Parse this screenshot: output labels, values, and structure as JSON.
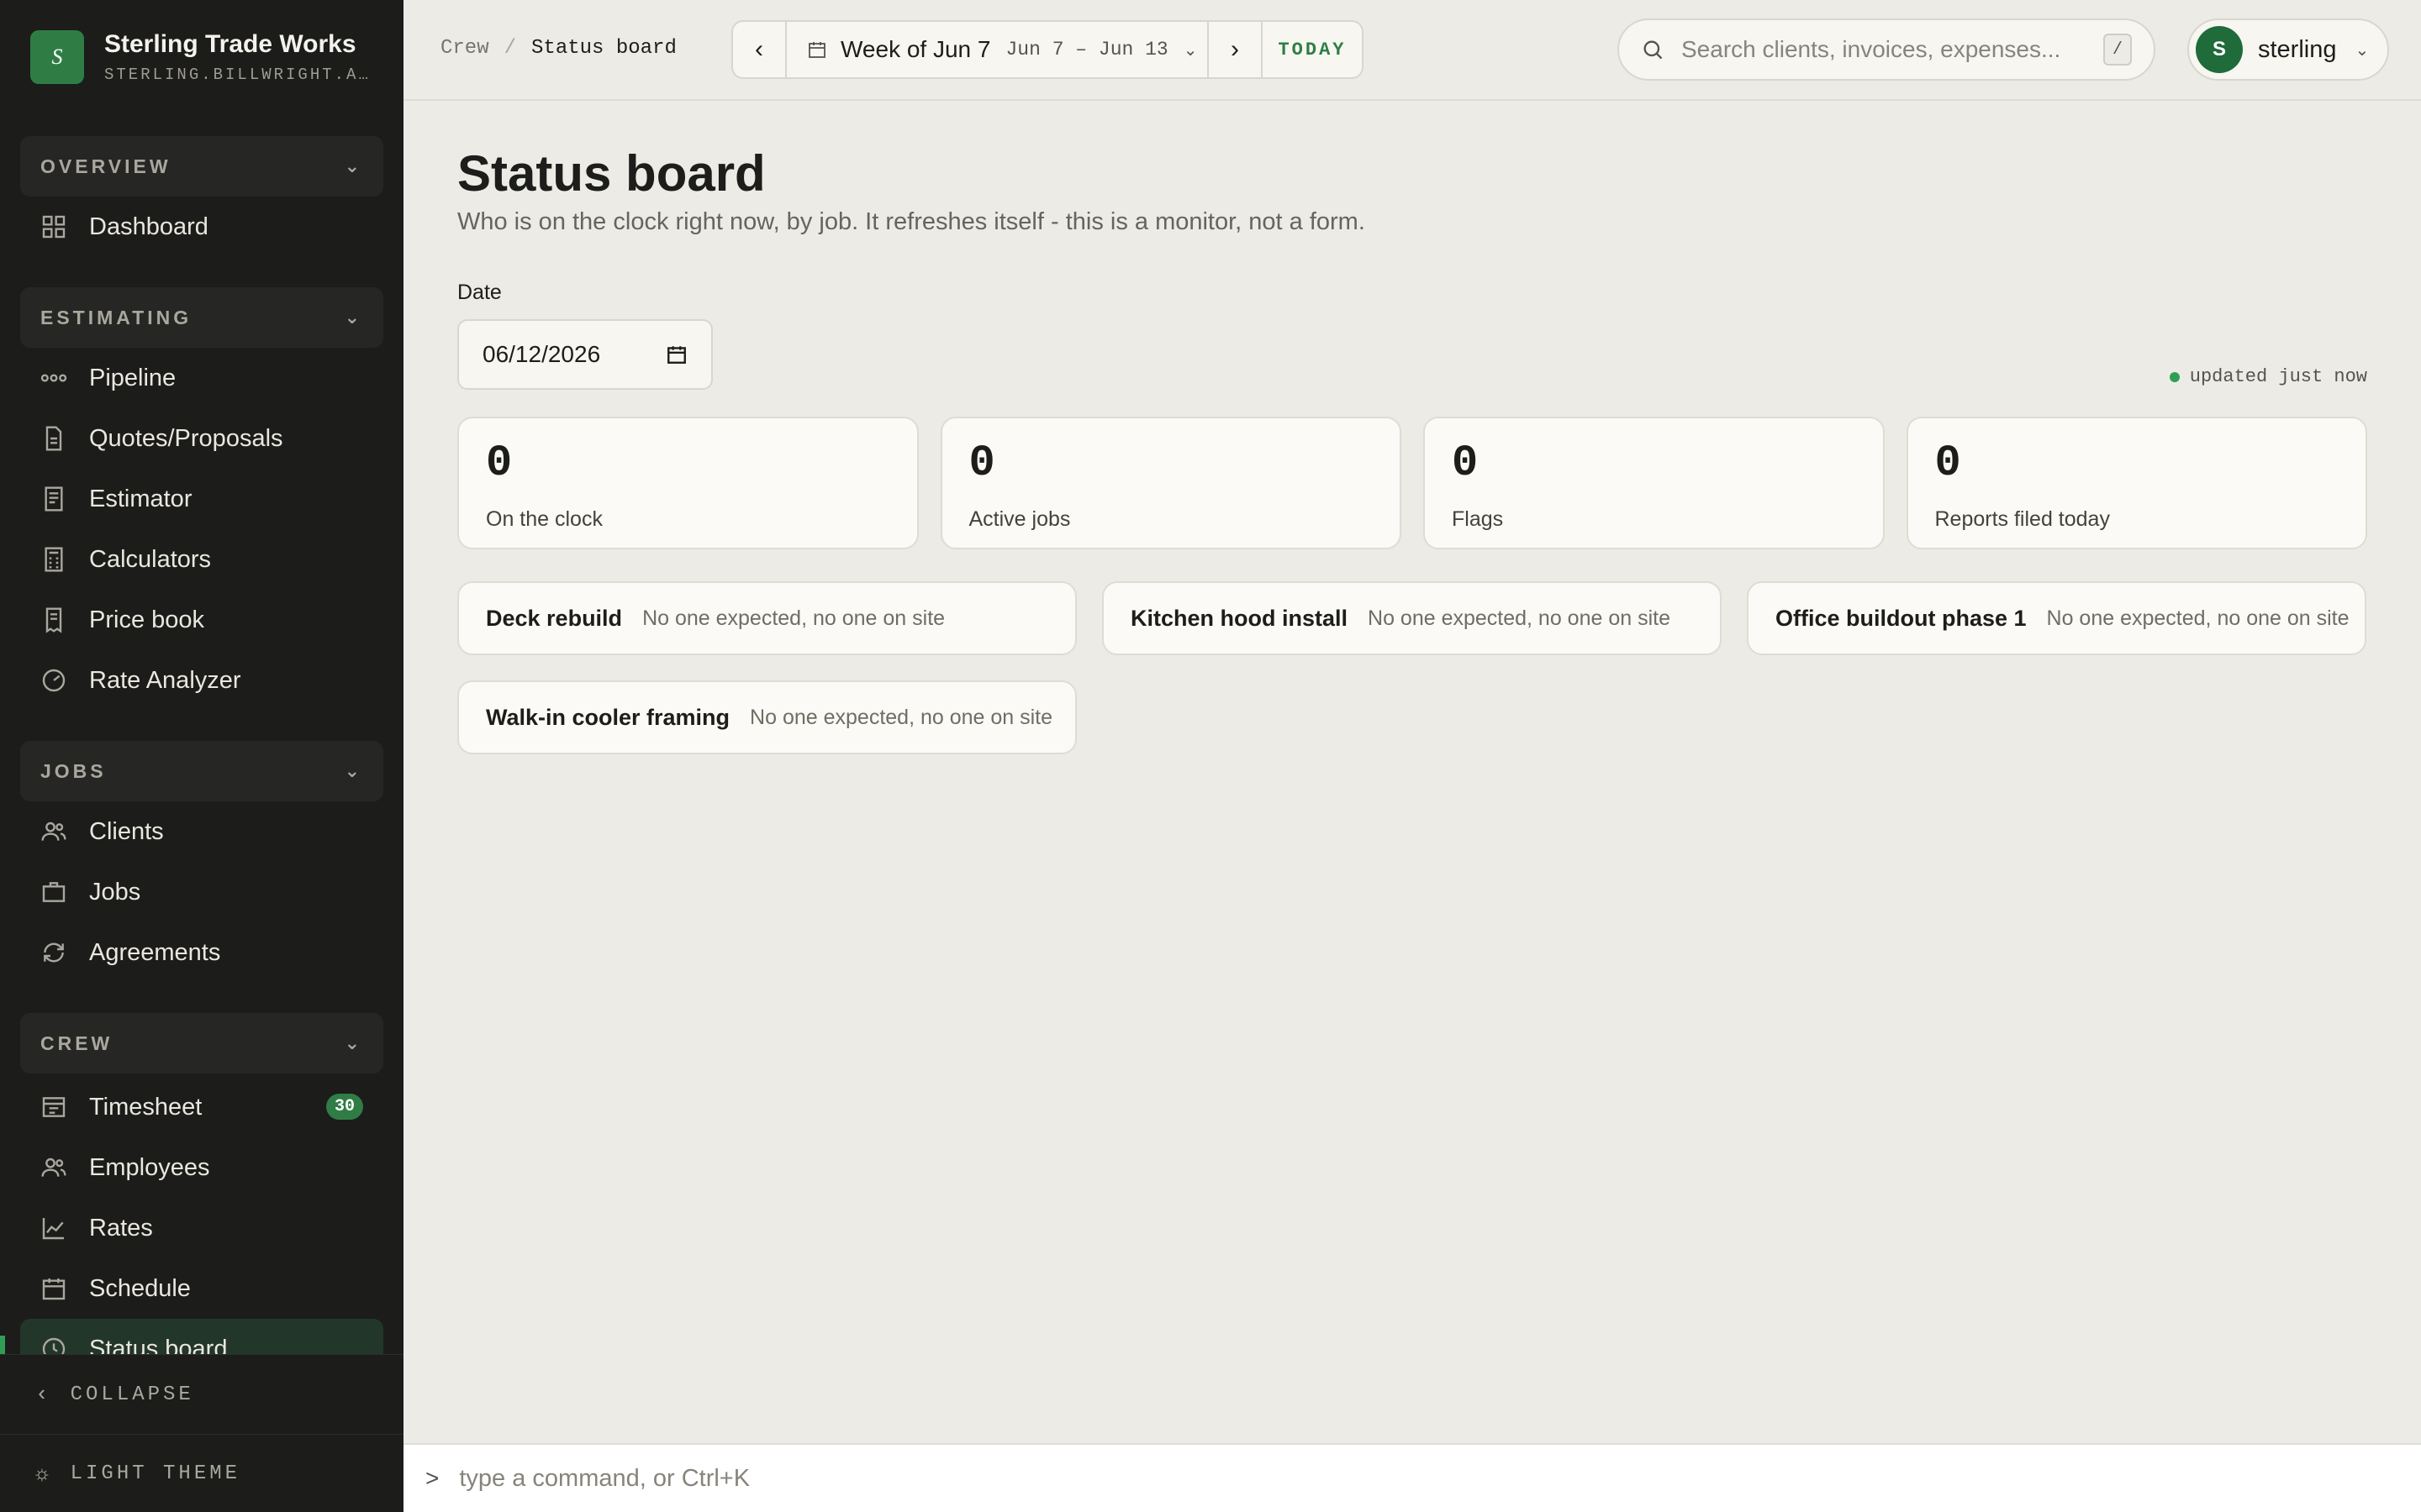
{
  "brand": {
    "name": "Sterling Trade Works",
    "url": "STERLING.BILLWRIGHT.APP",
    "logo_letter": "S"
  },
  "sidebar": {
    "groups": [
      {
        "label": "OVERVIEW",
        "items": [
          {
            "label": "Dashboard",
            "icon": "dashboard-icon"
          }
        ]
      },
      {
        "label": "ESTIMATING",
        "items": [
          {
            "label": "Pipeline",
            "icon": "pipeline-icon"
          },
          {
            "label": "Quotes/Proposals",
            "icon": "document-icon"
          },
          {
            "label": "Estimator",
            "icon": "estimator-icon"
          },
          {
            "label": "Calculators",
            "icon": "calculator-icon"
          },
          {
            "label": "Price book",
            "icon": "price-book-icon"
          },
          {
            "label": "Rate Analyzer",
            "icon": "gauge-icon"
          }
        ]
      },
      {
        "label": "JOBS",
        "items": [
          {
            "label": "Clients",
            "icon": "users-icon"
          },
          {
            "label": "Jobs",
            "icon": "briefcase-icon"
          },
          {
            "label": "Agreements",
            "icon": "refresh-icon"
          }
        ]
      },
      {
        "label": "CREW",
        "items": [
          {
            "label": "Timesheet",
            "icon": "timesheet-icon",
            "badge": "30"
          },
          {
            "label": "Employees",
            "icon": "users-icon"
          },
          {
            "label": "Rates",
            "icon": "chart-line-icon"
          },
          {
            "label": "Schedule",
            "icon": "calendar-icon"
          },
          {
            "label": "Status board",
            "icon": "clock-icon",
            "active": true
          }
        ]
      }
    ],
    "collapse_label": "COLLAPSE",
    "theme_label": "LIGHT THEME"
  },
  "topbar": {
    "breadcrumb": {
      "parent": "Crew",
      "separator": "/",
      "current": "Status board"
    },
    "week": {
      "label": "Week of Jun 7",
      "range": "Jun 7 – Jun 13",
      "today": "TODAY"
    },
    "search": {
      "placeholder": "Search clients, invoices, expenses...",
      "shortcut": "/"
    },
    "user": {
      "initial": "S",
      "name": "sterling"
    }
  },
  "main": {
    "title": "Status board",
    "subtitle": "Who is on the clock right now, by job. It refreshes itself - this is a monitor, not a form.",
    "date_label": "Date",
    "date_value": "06/12/2026",
    "updated": "updated just now",
    "stats": [
      {
        "value": "0",
        "label": "On the clock"
      },
      {
        "value": "0",
        "label": "Active jobs"
      },
      {
        "value": "0",
        "label": "Flags"
      },
      {
        "value": "0",
        "label": "Reports filed today"
      }
    ],
    "jobs": [
      {
        "name": "Deck rebuild",
        "status": "No one expected, no one on site"
      },
      {
        "name": "Kitchen hood install",
        "status": "No one expected, no one on site"
      },
      {
        "name": "Office buildout phase 1",
        "status": "No one expected, no one on site"
      },
      {
        "name": "Walk-in cooler framing",
        "status": "No one expected, no one on site"
      }
    ]
  },
  "command": {
    "prompt": ">",
    "placeholder": "type a command, or Ctrl+K"
  },
  "colors": {
    "accent": "#2f7d45",
    "sidebar_bg": "#1c1c1a",
    "page_bg": "#ecebe5"
  }
}
